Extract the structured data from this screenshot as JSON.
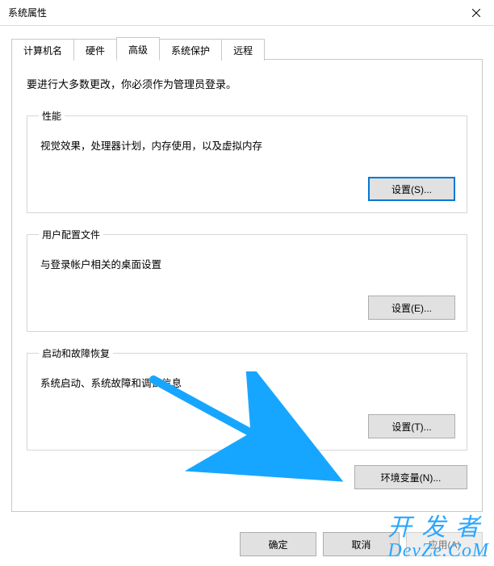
{
  "window": {
    "title": "系统属性"
  },
  "tabs": {
    "computer_name": "计算机名",
    "hardware": "硬件",
    "advanced": "高级",
    "system_protection": "系统保护",
    "remote": "远程"
  },
  "advanced_panel": {
    "intro": "要进行大多数更改，你必须作为管理员登录。",
    "performance": {
      "legend": "性能",
      "desc": "视觉效果，处理器计划，内存使用，以及虚拟内存",
      "settings_btn": "设置(S)..."
    },
    "user_profiles": {
      "legend": "用户配置文件",
      "desc": "与登录帐户相关的桌面设置",
      "settings_btn": "设置(E)..."
    },
    "startup_recovery": {
      "legend": "启动和故障恢复",
      "desc": "系统启动、系统故障和调试信息",
      "settings_btn": "设置(T)..."
    },
    "env_vars_btn": "环境变量(N)..."
  },
  "dialog_buttons": {
    "ok": "确定",
    "cancel": "取消",
    "apply": "应用(A)"
  },
  "watermark": {
    "line1": "开发者",
    "line2": "DevZe.CoM"
  },
  "annotation": {
    "arrow_color": "#17a6ff"
  }
}
